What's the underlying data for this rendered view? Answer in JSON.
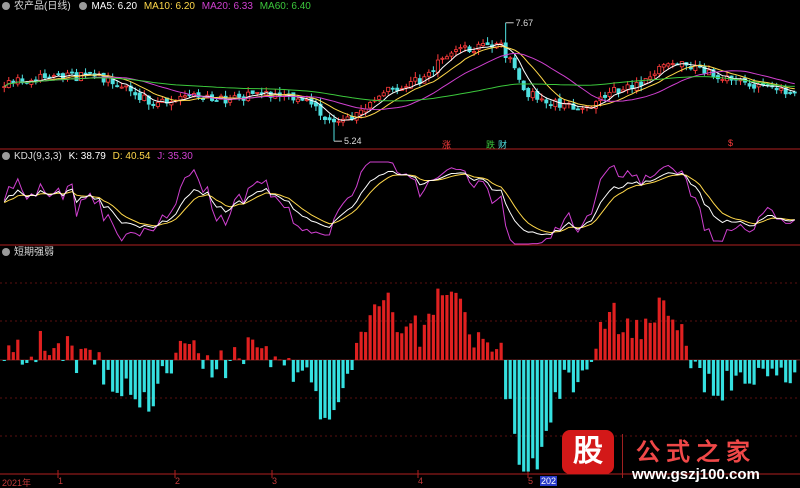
{
  "main_header": {
    "title": "农产品(日线)",
    "ma5": "MA5: 6.20",
    "ma10": "MA10: 6.20",
    "ma20": "MA20: 6.33",
    "ma60": "MA60: 6.40"
  },
  "kdj_header": {
    "name": "KDJ(9,3,3)",
    "k": "K: 38.79",
    "d": "D: 40.54",
    "j": "J: 35.30"
  },
  "strength_header": {
    "name": "短期强弱"
  },
  "markers": {
    "up": "涨",
    "down": "跌",
    "wealth": "财",
    "dollar": "$"
  },
  "watermark": {
    "badge": "股",
    "title": "公式之家",
    "url": "www.gszj100.com"
  },
  "colors": {
    "background": "#000000",
    "up_candle": "#ff3c3c",
    "down_candle": "#4fe0e0",
    "ma5": "#ffffff",
    "ma10": "#ffd84a",
    "ma20": "#d040d0",
    "ma60": "#3cc83c",
    "k_line": "#ffffff",
    "d_line": "#ffd84a",
    "j_line": "#d040d0",
    "hist_pos": "#e02020",
    "hist_neg": "#35e0e0",
    "divider": "#b02020"
  },
  "chart_data": [
    {
      "type": "candlestick",
      "title": "农产品(日线)",
      "period": "daily",
      "x_tick_labels": [
        "2021年",
        "1",
        "2",
        "3",
        "4",
        "5",
        "202"
      ],
      "annotations": [
        {
          "text": "7.67",
          "kind": "high"
        },
        {
          "text": "5.24",
          "kind": "low"
        }
      ],
      "ylim": [
        5.1,
        7.85
      ],
      "series": [
        {
          "name": "MA5",
          "value": 6.2
        },
        {
          "name": "MA10",
          "value": 6.2
        },
        {
          "name": "MA20",
          "value": 6.33
        },
        {
          "name": "MA60",
          "value": 6.4
        }
      ],
      "anchors": [
        {
          "i": 0,
          "p": 6.45
        },
        {
          "i": 10,
          "p": 6.55
        },
        {
          "i": 20,
          "p": 6.58
        },
        {
          "i": 27,
          "p": 6.35
        },
        {
          "i": 33,
          "p": 6.0
        },
        {
          "i": 40,
          "p": 6.2
        },
        {
          "i": 48,
          "p": 6.1
        },
        {
          "i": 58,
          "p": 6.2
        },
        {
          "i": 66,
          "p": 6.15
        },
        {
          "i": 72,
          "p": 5.6
        },
        {
          "i": 78,
          "p": 5.8
        },
        {
          "i": 85,
          "p": 6.3
        },
        {
          "i": 92,
          "p": 6.5
        },
        {
          "i": 100,
          "p": 7.15
        },
        {
          "i": 110,
          "p": 7.2
        },
        {
          "i": 116,
          "p": 6.2
        },
        {
          "i": 122,
          "p": 6.0
        },
        {
          "i": 128,
          "p": 5.9
        },
        {
          "i": 134,
          "p": 6.25
        },
        {
          "i": 141,
          "p": 6.45
        },
        {
          "i": 148,
          "p": 6.9
        },
        {
          "i": 153,
          "p": 6.75
        },
        {
          "i": 160,
          "p": 6.55
        },
        {
          "i": 167,
          "p": 6.35
        },
        {
          "i": 175,
          "p": 6.22
        }
      ],
      "n_bars": 176
    },
    {
      "type": "line",
      "title": "KDJ(9,3,3)",
      "series": [
        {
          "name": "K",
          "last": 38.79
        },
        {
          "name": "D",
          "last": 40.54
        },
        {
          "name": "J",
          "last": 35.3
        }
      ],
      "ylim": [
        -5,
        105
      ]
    },
    {
      "type": "bar",
      "title": "短期强弱",
      "ylim": [
        -35,
        32
      ]
    }
  ]
}
